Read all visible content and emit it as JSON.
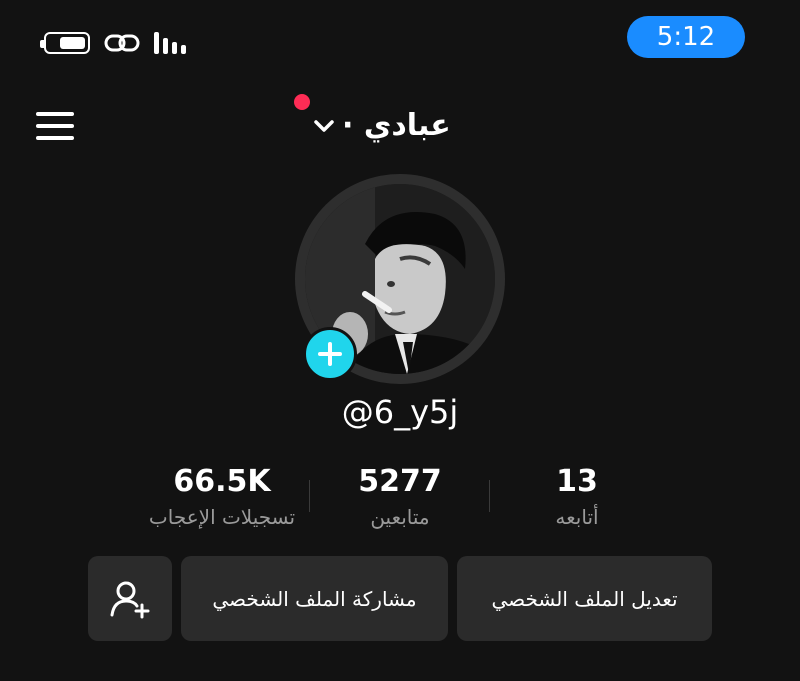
{
  "status_bar": {
    "time": "5:12",
    "battery_level": 0.6,
    "icons": [
      "battery-icon",
      "link-icon",
      "signal-icon"
    ]
  },
  "header": {
    "title": "عبادي ·",
    "menu_icon": "hamburger-menu-icon",
    "dropdown_icon": "chevron-down-icon",
    "notification_dot_color": "#fe2c55"
  },
  "profile": {
    "username": "@6_y5j",
    "add_badge_color": "#20d5ec",
    "avatar_icon": "profile-photo"
  },
  "stats": [
    {
      "value": "66.5K",
      "label": "تسجيلات الإعجاب"
    },
    {
      "value": "5277",
      "label": "متابعين"
    },
    {
      "value": "13",
      "label": "أتابعه"
    }
  ],
  "actions": {
    "edit_profile": "تعديل الملف الشخصي",
    "share_profile": "مشاركة الملف الشخصي",
    "add_friend_icon": "add-user-icon"
  },
  "accent_colors": {
    "time_pill": "#1a8cff"
  }
}
